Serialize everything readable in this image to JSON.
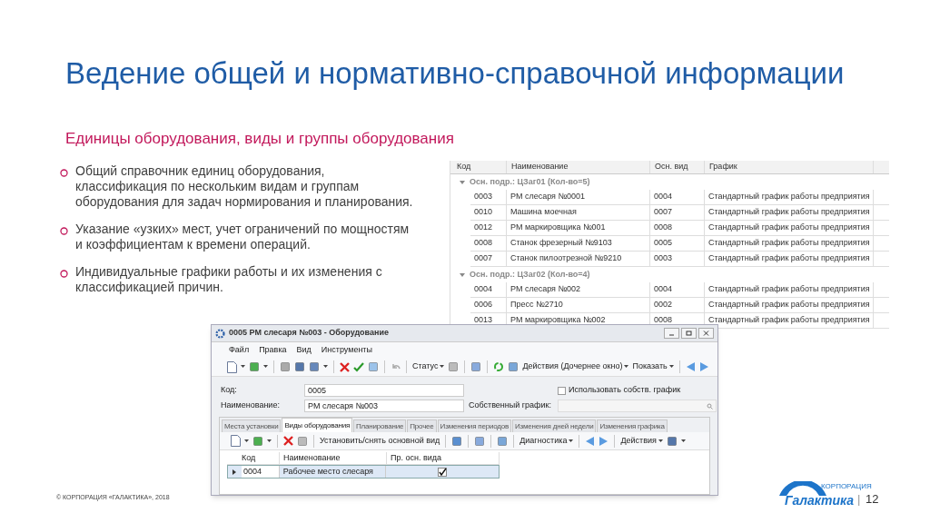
{
  "title": "Ведение общей и нормативно-справочной информации",
  "subtitle": "Единицы оборудования, виды и группы оборудования",
  "bullets": [
    "Общий справочник единиц оборудования, классификация по нескольким видам и группам оборудования для задач нормирования и планирования.",
    "Указание «узких» мест, учет ограничений по мощностям и коэффициентам к времени операций.",
    "Индивидуальные графики работы и их изменения с классификацией причин."
  ],
  "grid": {
    "columns": [
      "Код",
      "Наименование",
      "Осн. вид",
      "График"
    ],
    "groups": [
      {
        "label": "Осн. подр.: ЦЗаг01 (Кол-во=5)",
        "expanded": true,
        "rows": [
          [
            "0003",
            "РМ слесаря №0001",
            "0004",
            "Стандартный график работы предприятия"
          ],
          [
            "0010",
            "Машина моечная",
            "0007",
            "Стандартный график работы предприятия"
          ],
          [
            "0012",
            "РМ маркировщика №001",
            "0008",
            "Стандартный график работы предприятия"
          ],
          [
            "0008",
            "Станок фрезерный №9103",
            "0005",
            "Стандартный график работы предприятия"
          ],
          [
            "0007",
            "Станок пилоотрезной №9210",
            "0003",
            "Стандартный график работы предприятия"
          ]
        ]
      },
      {
        "label": "Осн. подр.: ЦЗаг02 (Кол-во=4)",
        "expanded": true,
        "rows": [
          [
            "0004",
            "РМ слесаря №002",
            "0004",
            "Стандартный график работы предприятия"
          ],
          [
            "0006",
            "Пресс №2710",
            "0002",
            "Стандартный график работы предприятия"
          ],
          [
            "0013",
            "РМ маркировщика №002",
            "0008",
            "Стандартный график работы предприятия"
          ]
        ]
      }
    ]
  },
  "window": {
    "title": "0005 РМ слесаря №003 - Оборудование",
    "menu": [
      "Файл",
      "Правка",
      "Вид",
      "Инструменты"
    ],
    "toolbar_labels": [
      "Статус",
      "Действия (Дочернее окно)",
      "Показать"
    ],
    "fields": [
      {
        "label": "Код:",
        "value": "0005"
      },
      {
        "label": "Наименование:",
        "value": "РМ слесаря №003"
      }
    ],
    "own_schedule_checkbox": {
      "label": "Использовать собств. график",
      "checked": false
    },
    "own_schedule_field": {
      "label": "Собственный график:"
    },
    "tabs": [
      {
        "label": "Места установки",
        "selected": false
      },
      {
        "label": "Виды оборудования",
        "selected": true
      },
      {
        "label": "Планирование",
        "selected": false
      },
      {
        "label": "Прочее",
        "selected": false
      },
      {
        "label": "Изменения периодов",
        "selected": false
      },
      {
        "label": "Изменения дней недели",
        "selected": false
      },
      {
        "label": "Изменения графика",
        "selected": false
      }
    ],
    "sub_toolbar_labels": [
      "Установить/снять основной вид",
      "Диагностика",
      "Действия"
    ],
    "sub_grid": {
      "columns": [
        "Код",
        "Наименование",
        "Пр. осн. вида"
      ],
      "rows": [
        {
          "code": "0004",
          "name": "Рабочее место слесаря",
          "primary": true,
          "selected": true
        }
      ]
    }
  },
  "footer": "© КОРПОРАЦИЯ «ГАЛАКТИКА», 2018",
  "logo": {
    "small": "КОРПОРАЦИЯ",
    "name": "Галактика"
  },
  "page_separator": "|",
  "page_number": "12"
}
